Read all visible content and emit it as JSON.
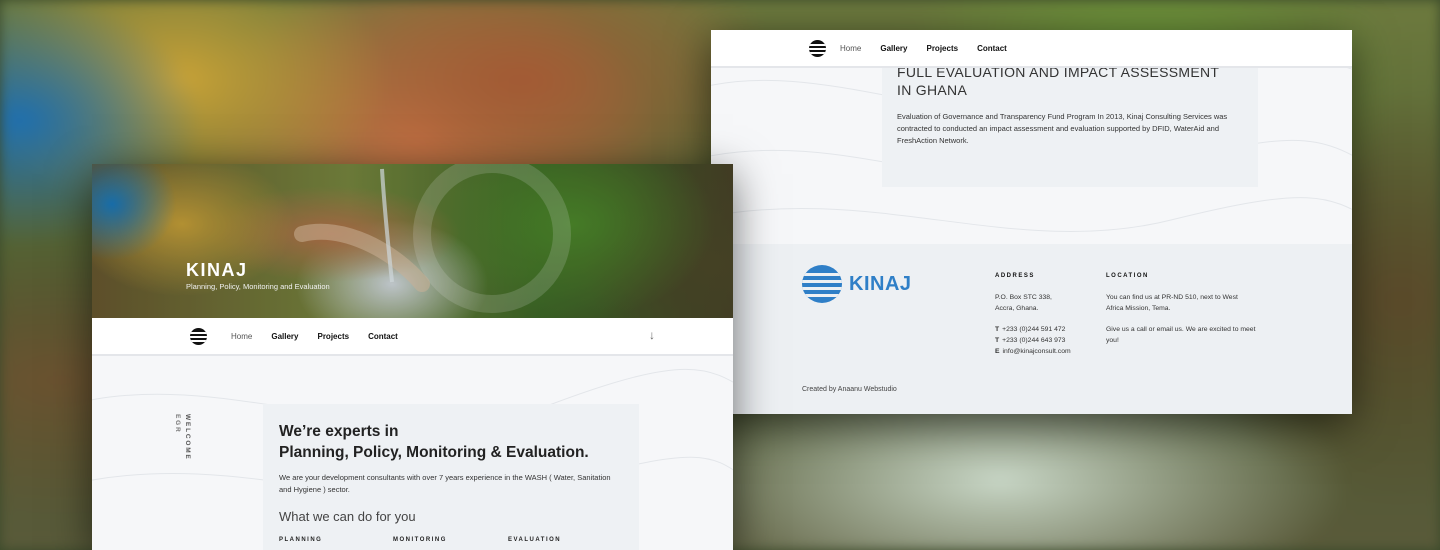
{
  "nav": {
    "items": [
      "Home",
      "Gallery",
      "Projects",
      "Contact"
    ]
  },
  "project": {
    "title": "FULL EVALUATION AND IMPACT ASSESSMENT IN GHANA",
    "description": "Evaluation of Governance and Transparency Fund Program In 2013, Kinaj Consulting Services was contracted to conducted an impact assessment and evaluation supported by DFID, WaterAid and FreshAction Network."
  },
  "footer": {
    "brand": "KINAJ",
    "address_heading": "ADDRESS",
    "address_line1": "P.O. Box STC 338,",
    "address_line2": "Accra, Ghana.",
    "phone1_label": "T",
    "phone1": "+233 (0)244 591 472",
    "phone2_label": "T",
    "phone2": "+233 (0)244 643 973",
    "email_label": "E",
    "email": "info@kinajconsult.com",
    "location_heading": "LOCATION",
    "location_text": "You can find us at PR-ND 510, next to West Africa Mission, Tema.",
    "location_cta": "Give us a call or email us. We are excited to meet you!",
    "credit": "Created by Anaanu Webstudio"
  },
  "hero": {
    "title": "KINAJ",
    "subtitle": "Planning, Policy, Monitoring and Evaluation"
  },
  "intro": {
    "side_label": "WELCOME",
    "side_label_cut": "EGR",
    "heading_line1": "We’re experts in",
    "heading_line2": "Planning, Policy, Monitoring & Evaluation.",
    "paragraph": "We are your development consultants with over 7 years experience in the WASH ( Water, Sanitation and Hygiene ) sector.",
    "services_heading": "What we can do for you",
    "services": [
      "PLANNING",
      "MONITORING",
      "EVALUATION"
    ]
  },
  "icons": {
    "scroll": "arrow-down-icon",
    "logo": "kinaj-logo-icon"
  },
  "colors": {
    "brand_blue": "#2f7fc7",
    "page_bg": "#f6f7f9",
    "card_bg": "#eef1f4"
  }
}
